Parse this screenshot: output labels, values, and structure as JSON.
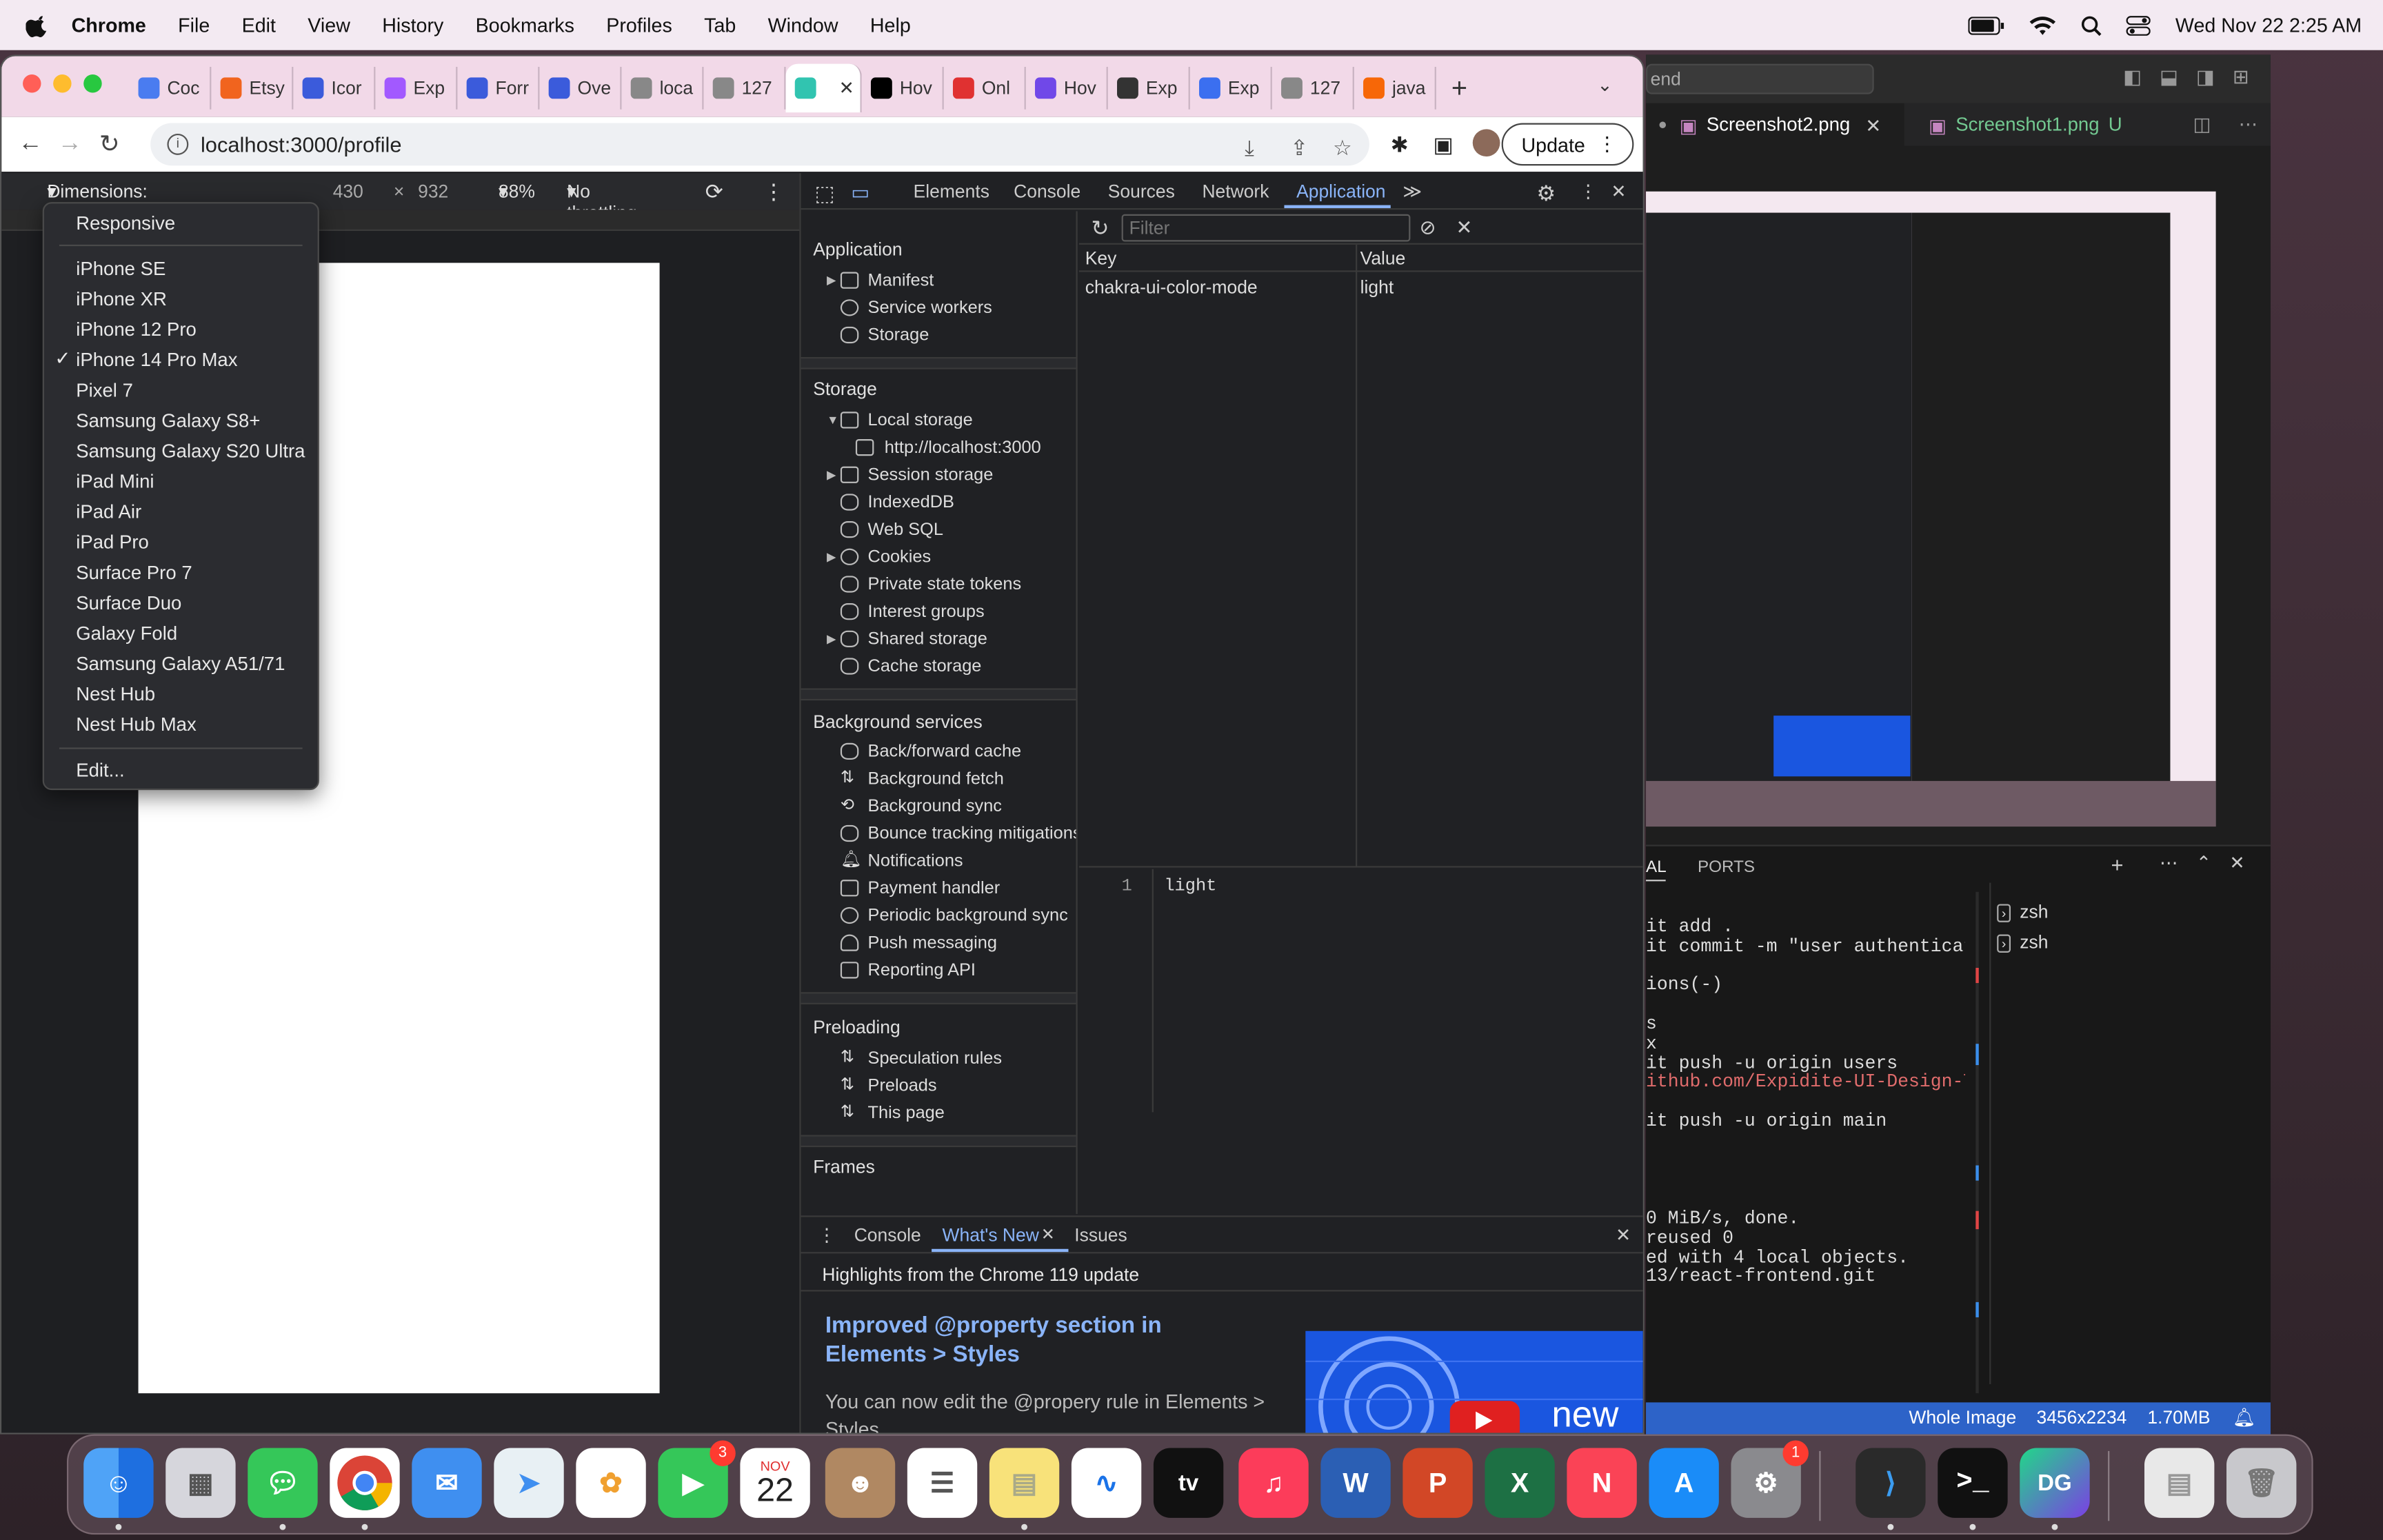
{
  "menubar": {
    "app": "Chrome",
    "items": [
      "File",
      "Edit",
      "View",
      "History",
      "Bookmarks",
      "Profiles",
      "Tab",
      "Window",
      "Help"
    ],
    "clock": "Wed Nov 22  2:25 AM"
  },
  "chrome": {
    "tabs": [
      {
        "label": "Coc",
        "color": "#4a7cf0"
      },
      {
        "label": "Etsy",
        "color": "#f1641e"
      },
      {
        "label": "Icor",
        "color": "#3b5bdb"
      },
      {
        "label": "Exp",
        "color": "#a259ff"
      },
      {
        "label": "Forr",
        "color": "#3b5bdb"
      },
      {
        "label": "Ove",
        "color": "#3b5bdb"
      },
      {
        "label": "loca",
        "color": "#888888"
      },
      {
        "label": "127",
        "color": "#888888"
      },
      {
        "label": "",
        "color": "#31c4b0"
      },
      {
        "label": "Hov",
        "color": "#000000"
      },
      {
        "label": "Onl",
        "color": "#e03131"
      },
      {
        "label": "Hov",
        "color": "#7048e8"
      },
      {
        "label": "Exp",
        "color": "#333333"
      },
      {
        "label": "Exp",
        "color": "#3b6ff0"
      },
      {
        "label": "127",
        "color": "#888888"
      },
      {
        "label": "java",
        "color": "#f76707"
      }
    ],
    "url": "localhost:3000/profile",
    "update_label": "Update"
  },
  "device_toolbar": {
    "dimensions_label": "Dimensions: iPhone 14 Pro Max",
    "width": "430",
    "times": "×",
    "height": "932",
    "zoom": "88%",
    "throttling": "No throttling"
  },
  "device_menu": {
    "responsive": "Responsive",
    "devices": [
      "iPhone SE",
      "iPhone XR",
      "iPhone 12 Pro",
      "iPhone 14 Pro Max",
      "Pixel 7",
      "Samsung Galaxy S8+",
      "Samsung Galaxy S20 Ultra",
      "iPad Mini",
      "iPad Air",
      "iPad Pro",
      "Surface Pro 7",
      "Surface Duo",
      "Galaxy Fold",
      "Samsung Galaxy A51/71",
      "Nest Hub",
      "Nest Hub Max"
    ],
    "selected": "iPhone 14 Pro Max",
    "edit": "Edit..."
  },
  "devtools": {
    "tabs": [
      "Elements",
      "Console",
      "Sources",
      "Network",
      "Application"
    ],
    "active_tab": "Application",
    "sidebar": {
      "application_header": "Application",
      "application_items": [
        "Manifest",
        "Service workers",
        "Storage"
      ],
      "storage_header": "Storage",
      "storage_items": [
        "Local storage",
        "http://localhost:3000",
        "Session storage",
        "IndexedDB",
        "Web SQL",
        "Cookies",
        "Private state tokens",
        "Interest groups",
        "Shared storage",
        "Cache storage"
      ],
      "background_header": "Background services",
      "background_items": [
        "Back/forward cache",
        "Background fetch",
        "Background sync",
        "Bounce tracking mitigations",
        "Notifications",
        "Payment handler",
        "Periodic background sync",
        "Push messaging",
        "Reporting API"
      ],
      "preloading_header": "Preloading",
      "preloading_items": [
        "Speculation rules",
        "Preloads",
        "This page"
      ],
      "frames_header": "Frames"
    },
    "filter_placeholder": "Filter",
    "table": {
      "key_header": "Key",
      "value_header": "Value",
      "rows": [
        {
          "key": "chakra-ui-color-mode",
          "value": "light"
        }
      ]
    },
    "preview": {
      "line": "1",
      "text": "light"
    },
    "drawer": {
      "tabs": [
        "Console",
        "What's New",
        "Issues"
      ],
      "active_tab": "What's New",
      "highlights": "Highlights from the Chrome 119 update",
      "feature_title": "Improved @property section in Elements > Styles",
      "feature_body": "You can now edit the @propery rule in Elements > Styles.",
      "image_badge": "new"
    }
  },
  "vscode": {
    "search_value": "end",
    "tabs": [
      {
        "label": "Screenshot2.png",
        "active": true
      },
      {
        "label": "Screenshot1.png",
        "status": "U"
      }
    ],
    "panel_tabs": [
      "AL",
      "PORTS"
    ],
    "terminals": [
      "zsh",
      "zsh"
    ],
    "terminal_lines": [
      "it add .",
      "it commit -m \"user authenticati",
      "",
      "ions(-)",
      "",
      "s",
      "x",
      "it push -u origin users",
      "ithub.com/Expidite-UI-Design-Te",
      "",
      "it push -u origin main",
      "",
      "",
      "",
      "",
      "0 MiB/s, done.",
      "reused 0",
      "ed with 4 local objects.",
      "13/react-frontend.git"
    ],
    "status": {
      "view": "Whole Image",
      "size": "3456x2234",
      "file_size": "1.70MB"
    }
  },
  "dock": {
    "calendar_month": "NOV",
    "calendar_day": "22",
    "facetime_badge": "3",
    "settings_badge": "1",
    "tv_label": "tv",
    "dg_label": "DG"
  }
}
